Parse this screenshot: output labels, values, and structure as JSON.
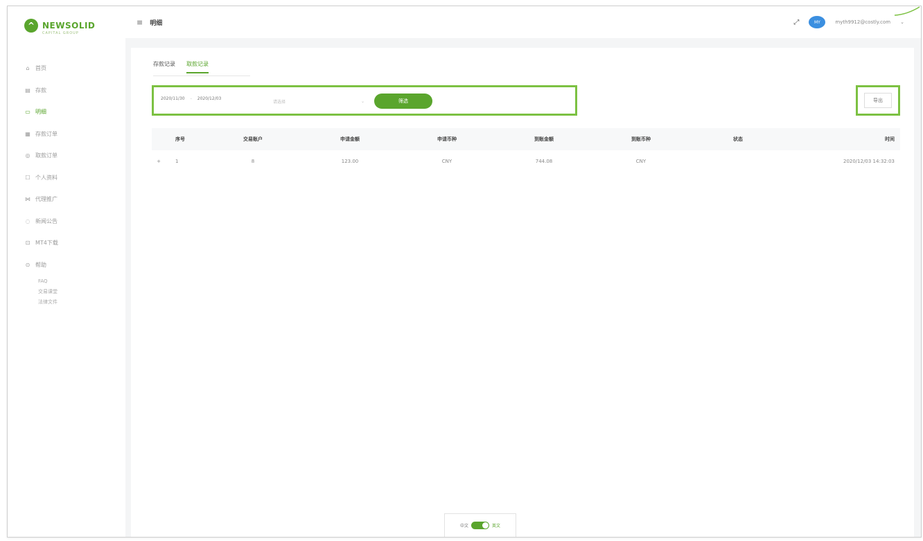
{
  "app": {
    "logo_text": "NEWSOLID",
    "logo_sub": "CAPITAL GROUP",
    "accent_color": "#5aa52d"
  },
  "header": {
    "title": "明细",
    "user_email": "myth9912@costly.com",
    "avatar_text": "MY"
  },
  "sidebar": {
    "items": [
      {
        "label": "首页",
        "icon": "home-icon"
      },
      {
        "label": "存款",
        "icon": "deposit-icon"
      },
      {
        "label": "明细",
        "icon": "detail-icon",
        "active": true
      },
      {
        "label": "存款订单",
        "icon": "order-icon"
      },
      {
        "label": "取款订单",
        "icon": "withdraw-order-icon"
      },
      {
        "label": "个人资料",
        "icon": "profile-icon"
      },
      {
        "label": "代理推广",
        "icon": "share-icon"
      },
      {
        "label": "新闻公告",
        "icon": "news-icon"
      },
      {
        "label": "MT4下载",
        "icon": "download-icon"
      },
      {
        "label": "帮助",
        "icon": "help-icon"
      }
    ],
    "sub_items": [
      "FAQ",
      "交易课堂",
      "法律文件"
    ]
  },
  "tabs": [
    {
      "label": "存款记录",
      "active": false
    },
    {
      "label": "取款记录",
      "active": true
    }
  ],
  "filter": {
    "date_start": "2020/11/30",
    "date_end": "2020/12/03",
    "date_separator": "-",
    "select_placeholder": "请选择",
    "filter_button": "筛选",
    "export_button": "导出"
  },
  "table": {
    "headers": [
      "序号",
      "交易账户",
      "申请金额",
      "申请币种",
      "到账金额",
      "到账币种",
      "状态",
      "时间"
    ],
    "rows": [
      {
        "expand": "+",
        "index": "1",
        "account": "8",
        "apply_amount": "123.00",
        "apply_currency": "CNY",
        "arrive_amount": "744.08",
        "arrive_currency": "CNY",
        "status": "",
        "time": "2020/12/03 14:32:03"
      }
    ]
  },
  "language_toggle": {
    "left_label": "中文",
    "right_label": "英文"
  }
}
